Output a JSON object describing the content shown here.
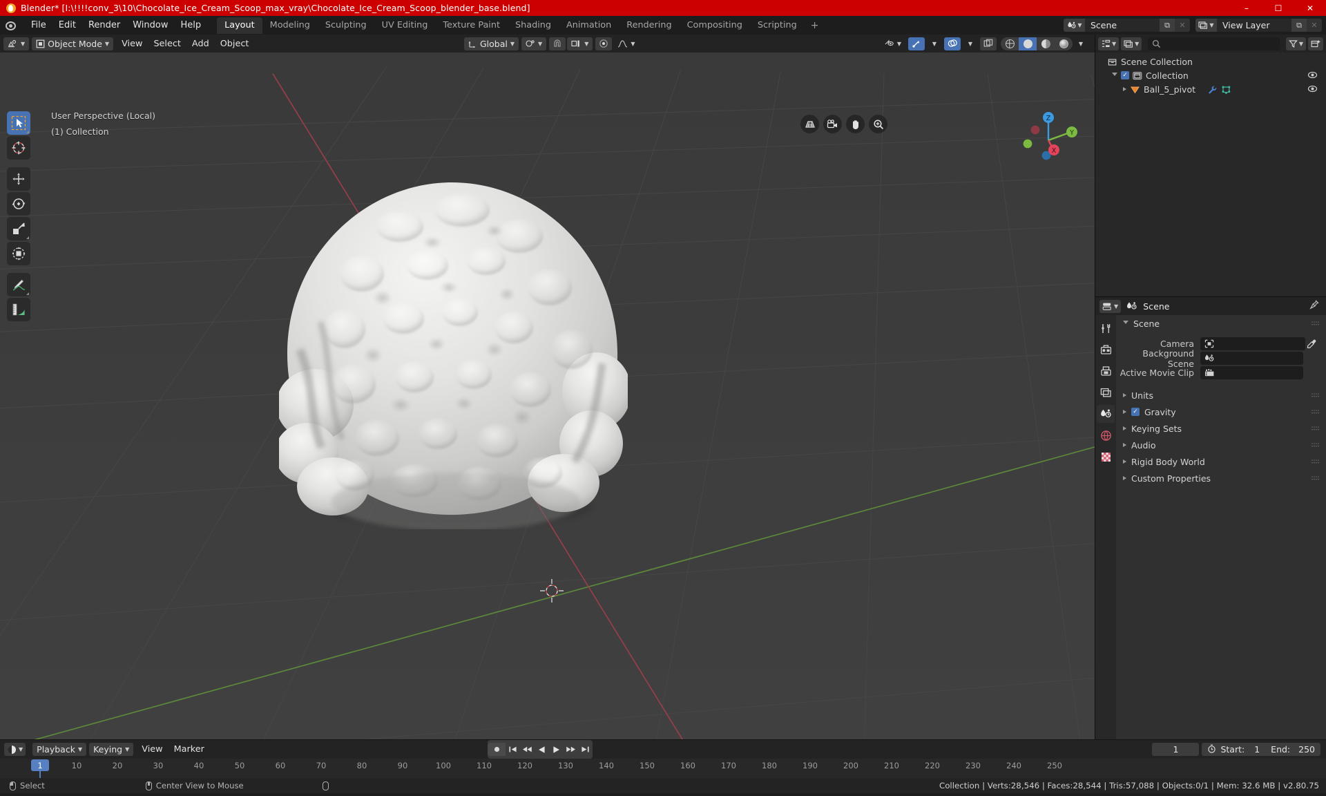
{
  "window": {
    "title": "Blender* [I:\\!!!!conv_3\\10\\Chocolate_Ice_Cream_Scoop_max_vray\\Chocolate_Ice_Cream_Scoop_blender_base.blend]",
    "minimize": "–",
    "maximize": "☐",
    "close": "✕",
    "title_bg": "#cc0000"
  },
  "topbar": {
    "menus": [
      "File",
      "Edit",
      "Render",
      "Window",
      "Help"
    ],
    "tabs": [
      {
        "label": "Layout",
        "active": true
      },
      {
        "label": "Modeling",
        "active": false
      },
      {
        "label": "Sculpting",
        "active": false
      },
      {
        "label": "UV Editing",
        "active": false
      },
      {
        "label": "Texture Paint",
        "active": false
      },
      {
        "label": "Shading",
        "active": false
      },
      {
        "label": "Animation",
        "active": false
      },
      {
        "label": "Rendering",
        "active": false
      },
      {
        "label": "Compositing",
        "active": false
      },
      {
        "label": "Scripting",
        "active": false
      }
    ],
    "add_tab": "+",
    "scene_name": "Scene",
    "view_layer_name": "View Layer",
    "new_btn": "⧉",
    "unlink_btn": "✕"
  },
  "viewport_header": {
    "mode": "Object Mode",
    "menus": [
      "View",
      "Select",
      "Add",
      "Object"
    ],
    "transform_orientation": "Global",
    "snap_on": true,
    "proportional_on": false
  },
  "viewport": {
    "overlay_line1": "User Perspective (Local)",
    "overlay_line2": "(1) Collection",
    "gizmo_axes": [
      "X",
      "Y",
      "Z"
    ],
    "tools": [
      {
        "name": "tweak-select-box",
        "active": true
      },
      {
        "name": "cursor",
        "active": false
      },
      {
        "name": "move",
        "active": false
      },
      {
        "name": "rotate",
        "active": false
      },
      {
        "name": "scale",
        "active": false
      },
      {
        "name": "transform",
        "active": false
      },
      {
        "name": "annotate",
        "active": false
      },
      {
        "name": "measure",
        "active": false
      }
    ],
    "nav_buttons": [
      "grid-toggle",
      "camera-view",
      "pan-view",
      "zoom-view"
    ],
    "shading_modes": [
      "wireframe",
      "solid",
      "material",
      "rendered"
    ],
    "shading_active": "solid"
  },
  "outliner": {
    "display_mode": "View Layer",
    "search_placeholder": "",
    "filter_label": "filter",
    "new_collection_label": "new-collection",
    "rows": [
      {
        "label": "Scene Collection",
        "depth": 0,
        "icon": "collection-icon",
        "expand": "none",
        "checkbox": false,
        "eye": false
      },
      {
        "label": "Collection",
        "depth": 1,
        "icon": "collection-icon",
        "expand": "down",
        "checkbox": true,
        "eye": true
      },
      {
        "label": "Ball_5_pivot",
        "depth": 2,
        "icon": "mesh-object-icon",
        "expand": "right",
        "checkbox": false,
        "eye": true,
        "extra_icons": [
          "modifier-wrench-icon",
          "mesh-data-icon"
        ]
      }
    ]
  },
  "properties": {
    "breadcrumb": "Scene",
    "pin_label": "pin",
    "tabs": [
      "tool-icon",
      "render-icon",
      "output-icon",
      "view-layer-icon",
      "scene-icon",
      "world-icon",
      "texture-icon"
    ],
    "active_tab": "scene-icon",
    "section_header": "Scene",
    "fields": [
      {
        "label": "Camera",
        "value": "",
        "icon": "camera-data-icon",
        "eyedropper": true
      },
      {
        "label": "Background Scene",
        "value": "",
        "icon": "scene-icon",
        "eyedropper": false
      },
      {
        "label": "Active Movie Clip",
        "value": "",
        "icon": "movieclip-icon",
        "eyedropper": false
      }
    ],
    "panels": [
      {
        "label": "Units",
        "checkbox": false,
        "checked": false
      },
      {
        "label": "Gravity",
        "checkbox": true,
        "checked": true
      },
      {
        "label": "Keying Sets",
        "checkbox": false,
        "checked": false
      },
      {
        "label": "Audio",
        "checkbox": false,
        "checked": false
      },
      {
        "label": "Rigid Body World",
        "checkbox": false,
        "checked": false
      },
      {
        "label": "Custom Properties",
        "checkbox": false,
        "checked": false
      }
    ]
  },
  "timeline": {
    "editor_type": "timeline-icon",
    "menus": [
      "Playback",
      "Keying",
      "View",
      "Marker"
    ],
    "current_frame": "1",
    "start_label": "Start:",
    "start_value": "1",
    "end_label": "End:",
    "end_value": "250",
    "auto_key_label": "auto-keying",
    "transport": [
      "jump-start",
      "prev-keyframe",
      "play-reverse",
      "play",
      "next-keyframe",
      "jump-end"
    ],
    "ticks": [
      "10",
      "20",
      "30",
      "40",
      "50",
      "60",
      "70",
      "80",
      "90",
      "100",
      "110",
      "120",
      "130",
      "140",
      "150",
      "160",
      "170",
      "180",
      "190",
      "200",
      "210",
      "220",
      "230",
      "240",
      "250"
    ],
    "playhead_label": "1"
  },
  "statusbar": {
    "hints": [
      {
        "icon": "mouse-left-icon",
        "label": "Select"
      },
      {
        "icon": "mouse-middle-icon",
        "label": "Center View to Mouse"
      },
      {
        "icon": "mouse-right-icon",
        "label": ""
      }
    ],
    "stats": "Collection | Verts:28,546 | Faces:28,544 | Tris:57,088 | Objects:0/1 | Mem: 32.6 MB | v2.80.75"
  }
}
